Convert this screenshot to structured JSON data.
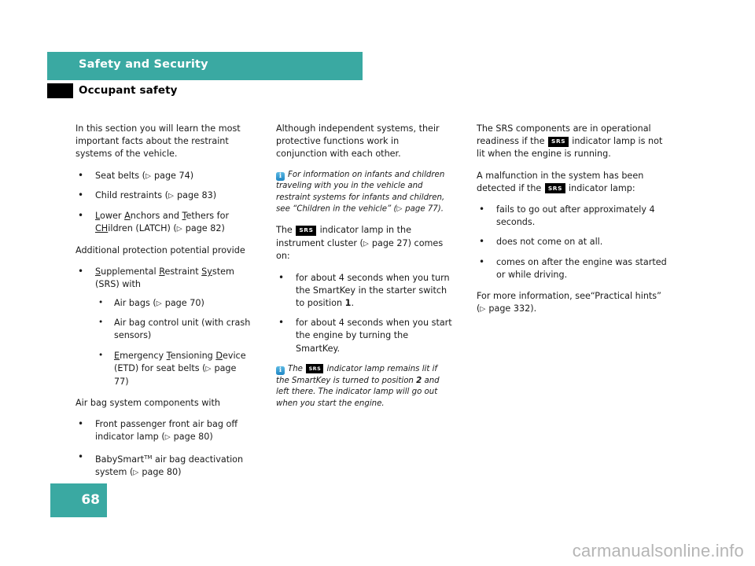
{
  "header": {
    "chapter_title": "Safety and Security",
    "section_title": "Occupant safety",
    "bar_color": "#3aa9a2",
    "marker_color": "#000000"
  },
  "footer": {
    "page_number": "68",
    "block_color": "#3aa9a2",
    "watermark": "carmanualsonline.info"
  },
  "icons": {
    "info_icon_letter": "i",
    "info_icon_color": "#2196cf",
    "srs_badge_label": "SRS",
    "srs_badge_color": "#000000",
    "page_ref_glyph": "▷"
  },
  "column_1": {
    "intro": "In this section you will learn the most important facts about the restraint systems of the vehicle.",
    "bullet_1": "Seat belts (",
    "bullet_1_ref": "page 74)",
    "bullet_2": "Child restraints (",
    "bullet_2_ref": "page 83)",
    "bullet_3_a": "L",
    "bullet_3_b": "ower ",
    "bullet_3_c": "A",
    "bullet_3_d": "nchors and ",
    "bullet_3_e": "T",
    "bullet_3_f": "ethers for ",
    "bullet_3_g": "CH",
    "bullet_3_h": "ildren (LATCH) (",
    "bullet_3_ref": "page 82)",
    "para_2": "Additional protection potential provide",
    "srs_bullet_a": "S",
    "srs_bullet_b": "upplemental ",
    "srs_bullet_c": "R",
    "srs_bullet_d": "estraint ",
    "srs_bullet_e": "Sy",
    "srs_bullet_f": "stem (SRS) with",
    "sub_1": "Air bags (",
    "sub_1_ref": "page 70)",
    "sub_2": "Air bag control unit (with crash sensors)",
    "sub_3_a": "E",
    "sub_3_b": "mergency ",
    "sub_3_c": "T",
    "sub_3_d": "ensioning ",
    "sub_3_e": "D",
    "sub_3_f": "evice (ETD) for seat belts (",
    "sub_3_ref": "page 77)",
    "para_3": "Air bag system components with",
    "ab_bullet_1": "Front passenger front air bag off indicator lamp (",
    "ab_bullet_1_ref": "page 80)",
    "ab_bullet_2_a": "BabySmart",
    "ab_bullet_2_tm": "TM",
    "ab_bullet_2_b": " air bag deactivation system (",
    "ab_bullet_2_ref": "page 80)"
  },
  "column_2": {
    "para_1": "Although independent systems, their protective functions work in conjunction with each other.",
    "note_1_a": "For information on infants and children traveling with you in the vehicle and restraint systems for infants and children, see “Children in the vehicle” (",
    "note_1_ref": "page 77).",
    "para_2_a": "The ",
    "para_2_b": " indicator lamp in the instrument cluster (",
    "para_2_ref": "page 27)",
    "para_2_c": " comes on:",
    "bullet_1_a": "for about 4 seconds when you turn the SmartKey in the starter switch to position ",
    "bullet_1_bold": "1",
    "bullet_1_b": ".",
    "bullet_2": "for about 4 seconds when you start the engine by turning the SmartKey.",
    "note_2_a": "The ",
    "note_2_b": " indicator lamp remains lit if the SmartKey is turned to position ",
    "note_2_bold": "2",
    "note_2_c": " and left there. The indicator lamp will go out when you start the engine."
  },
  "column_3": {
    "para_1_a": "The SRS components are in operational readiness if the ",
    "para_1_b": " indicator lamp is not lit when the engine is running.",
    "para_2_a": "A malfunction in the system has been detected if the ",
    "para_2_b": " indicator lamp:",
    "bullet_1": "fails to go out after approximately 4 seconds.",
    "bullet_2": "does not come on at all.",
    "bullet_3": "comes on after the engine was started or while driving.",
    "para_3": "For more information, see“Practical hints” (",
    "para_3_ref": "page 332)."
  }
}
